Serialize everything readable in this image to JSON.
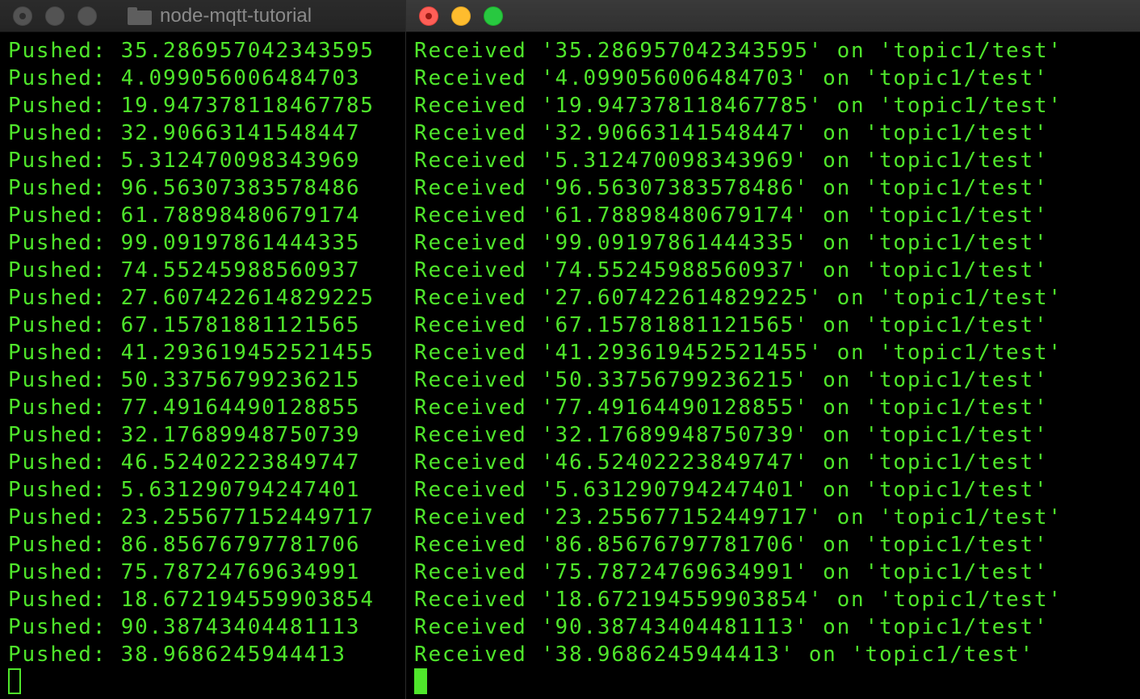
{
  "left_window": {
    "title": "node-mqtt-tutorial",
    "lines": [
      "Pushed: 35.286957042343595",
      "Pushed: 4.099056006484703",
      "Pushed: 19.947378118467785",
      "Pushed: 32.90663141548447",
      "Pushed: 5.312470098343969",
      "Pushed: 96.56307383578486",
      "Pushed: 61.78898480679174",
      "Pushed: 99.09197861444335",
      "Pushed: 74.55245988560937",
      "Pushed: 27.607422614829225",
      "Pushed: 67.15781881121565",
      "Pushed: 41.293619452521455",
      "Pushed: 50.33756799236215",
      "Pushed: 77.49164490128855",
      "Pushed: 32.17689948750739",
      "Pushed: 46.52402223849747",
      "Pushed: 5.631290794247401",
      "Pushed: 23.255677152449717",
      "Pushed: 86.85676797781706",
      "Pushed: 75.78724769634991",
      "Pushed: 18.672194559903854",
      "Pushed: 90.38743404481113",
      "Pushed: 38.9686245944413"
    ]
  },
  "right_window": {
    "lines": [
      "Received '35.286957042343595' on 'topic1/test'",
      "Received '4.099056006484703' on 'topic1/test'",
      "Received '19.947378118467785' on 'topic1/test'",
      "Received '32.90663141548447' on 'topic1/test'",
      "Received '5.312470098343969' on 'topic1/test'",
      "Received '96.56307383578486' on 'topic1/test'",
      "Received '61.78898480679174' on 'topic1/test'",
      "Received '99.09197861444335' on 'topic1/test'",
      "Received '74.55245988560937' on 'topic1/test'",
      "Received '27.607422614829225' on 'topic1/test'",
      "Received '67.15781881121565' on 'topic1/test'",
      "Received '41.293619452521455' on 'topic1/test'",
      "Received '50.33756799236215' on 'topic1/test'",
      "Received '77.49164490128855' on 'topic1/test'",
      "Received '32.17689948750739' on 'topic1/test'",
      "Received '46.52402223849747' on 'topic1/test'",
      "Received '5.631290794247401' on 'topic1/test'",
      "Received '23.255677152449717' on 'topic1/test'",
      "Received '86.85676797781706' on 'topic1/test'",
      "Received '75.78724769634991' on 'topic1/test'",
      "Received '18.672194559903854' on 'topic1/test'",
      "Received '90.38743404481113' on 'topic1/test'",
      "Received '38.9686245944413' on 'topic1/test'"
    ]
  },
  "icons": {
    "title_icon": "folder-icon"
  },
  "colors": {
    "terminal_text": "#4fe62b",
    "terminal_background": "#000000",
    "close_button": "#fe5f57",
    "minimize_button": "#febc2e",
    "zoom_button": "#28c840",
    "inactive_button": "#535353"
  }
}
